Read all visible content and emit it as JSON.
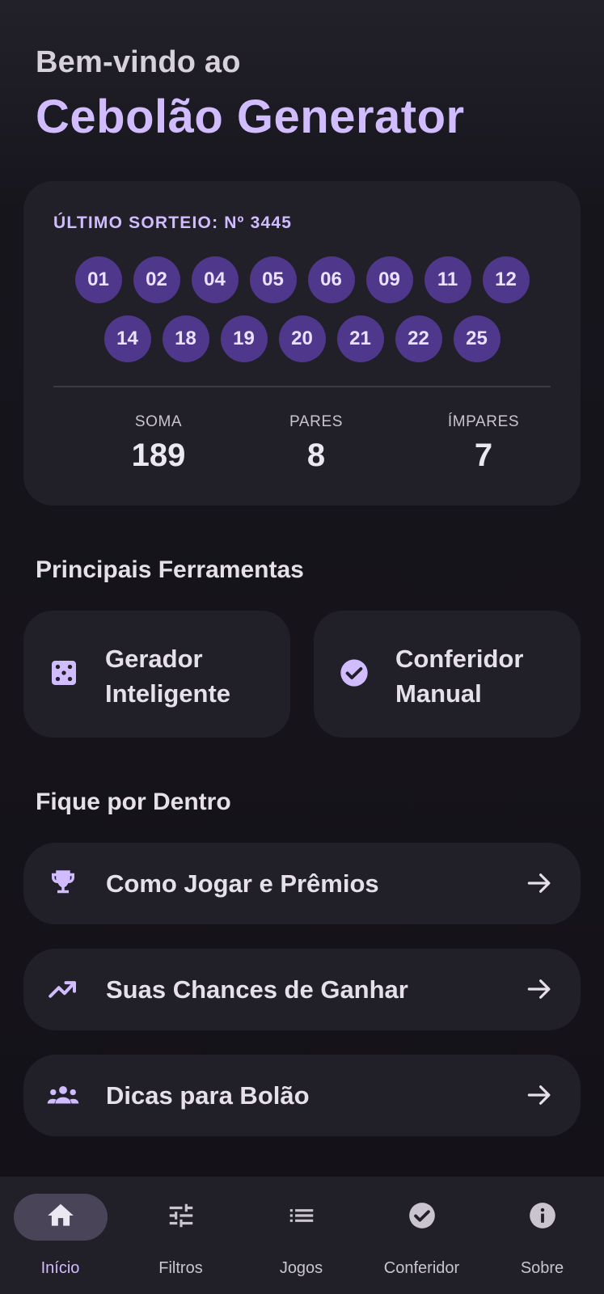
{
  "header": {
    "welcome": "Bem-vindo ao",
    "app_title": "Cebolão Generator"
  },
  "last_draw": {
    "title": "ÚLTIMO SORTEIO: Nº 3445",
    "numbers_row1": [
      "01",
      "02",
      "04",
      "05",
      "06",
      "09",
      "11",
      "12"
    ],
    "numbers_row2": [
      "14",
      "18",
      "19",
      "20",
      "21",
      "22",
      "25"
    ],
    "stats": [
      {
        "label": "SOMA",
        "value": "189"
      },
      {
        "label": "PARES",
        "value": "8"
      },
      {
        "label": "ÍMPARES",
        "value": "7"
      }
    ]
  },
  "tools": {
    "title": "Principais Ferramentas",
    "items": [
      {
        "label": "Gerador\nInteligente",
        "icon": "dice-icon"
      },
      {
        "label": "Conferidor\nManual",
        "icon": "check-circle-icon"
      }
    ]
  },
  "info": {
    "title": "Fique por Dentro",
    "items": [
      {
        "label": "Como Jogar e Prêmios",
        "icon": "trophy-icon"
      },
      {
        "label": "Suas Chances de Ganhar",
        "icon": "trending-up-icon"
      },
      {
        "label": "Dicas para Bolão",
        "icon": "group-icon"
      }
    ]
  },
  "nav": {
    "items": [
      {
        "label": "Início",
        "icon": "home-icon",
        "active": true
      },
      {
        "label": "Filtros",
        "icon": "tune-icon",
        "active": false
      },
      {
        "label": "Jogos",
        "icon": "list-icon",
        "active": false
      },
      {
        "label": "Conferidor",
        "icon": "check-circle-icon",
        "active": false
      },
      {
        "label": "Sobre",
        "icon": "info-icon",
        "active": false
      }
    ]
  },
  "colors": {
    "background": "#15131a",
    "card": "#211f28",
    "accent": "#d0bcff",
    "ball": "#4f378b",
    "nav_active_pill": "#4a4458"
  }
}
